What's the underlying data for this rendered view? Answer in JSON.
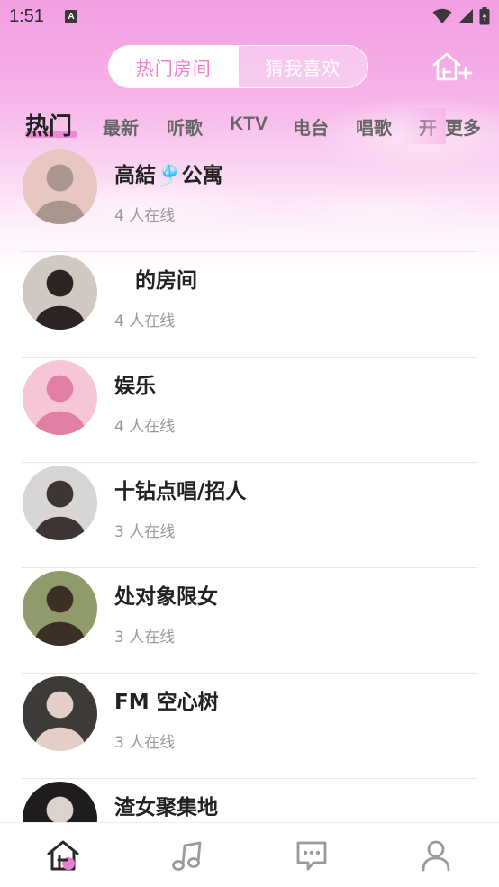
{
  "status_bar": {
    "time": "1:51",
    "app_icon_letter": "A"
  },
  "header": {
    "segments": [
      {
        "label": "热门房间",
        "active": true
      },
      {
        "label": "猜我喜欢",
        "active": false
      }
    ],
    "add_room_icon": "home-plus-icon"
  },
  "tabs": {
    "items": [
      "热门",
      "最新",
      "听歌",
      "KTV",
      "电台",
      "唱歌",
      "开"
    ],
    "active_index": 0,
    "more_label": "更多"
  },
  "rooms": [
    {
      "name": "高結🎐公寓",
      "online": "4 人在线",
      "avatar_palette": [
        "#e8c6c2",
        "#a8968f"
      ]
    },
    {
      "name": "　的房间",
      "online": "4 人在线",
      "avatar_palette": [
        "#cfc9c2",
        "#2b2422"
      ]
    },
    {
      "name": "娱乐",
      "online": "4 人在线",
      "avatar_palette": [
        "#f6c6d6",
        "#e27fa5"
      ]
    },
    {
      "name": "十钻点唱/招人",
      "online": "3 人在线",
      "avatar_palette": [
        "#d8d6d4",
        "#3c3533"
      ]
    },
    {
      "name": "处对象限女",
      "online": "3 人在线",
      "avatar_palette": [
        "#8f9b6a",
        "#3b2f26"
      ]
    },
    {
      "name": "FM 空心树",
      "online": "3 人在线",
      "avatar_palette": [
        "#3e3a38",
        "#e2cfc8"
      ]
    },
    {
      "name": "渣女聚集地",
      "online": "",
      "avatar_palette": [
        "#1e1c1c",
        "#dcd2ce"
      ]
    }
  ],
  "bottom_nav": {
    "items": [
      "home-icon",
      "music-icon",
      "message-icon",
      "profile-icon"
    ],
    "active_index": 0,
    "accent": "#ea7fd0"
  }
}
